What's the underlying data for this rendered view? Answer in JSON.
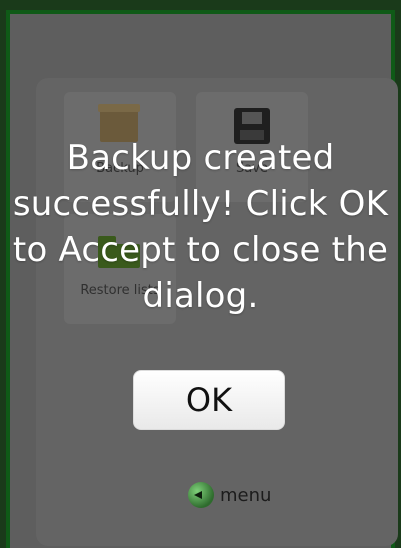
{
  "background_tiles": {
    "backup_label": "Backup",
    "save_label": "Save",
    "restore_label": "Restore lists"
  },
  "dialog": {
    "message": "Backup created successfully! Click OK to Accept to close the dialog.",
    "ok_label": "OK"
  },
  "footer": {
    "menu_label": "menu",
    "menu_icon": "back-arrow-icon"
  },
  "colors": {
    "border_green": "#0f5a17",
    "overlay_gray": "#5e5e5e",
    "button_white": "#ffffff"
  }
}
